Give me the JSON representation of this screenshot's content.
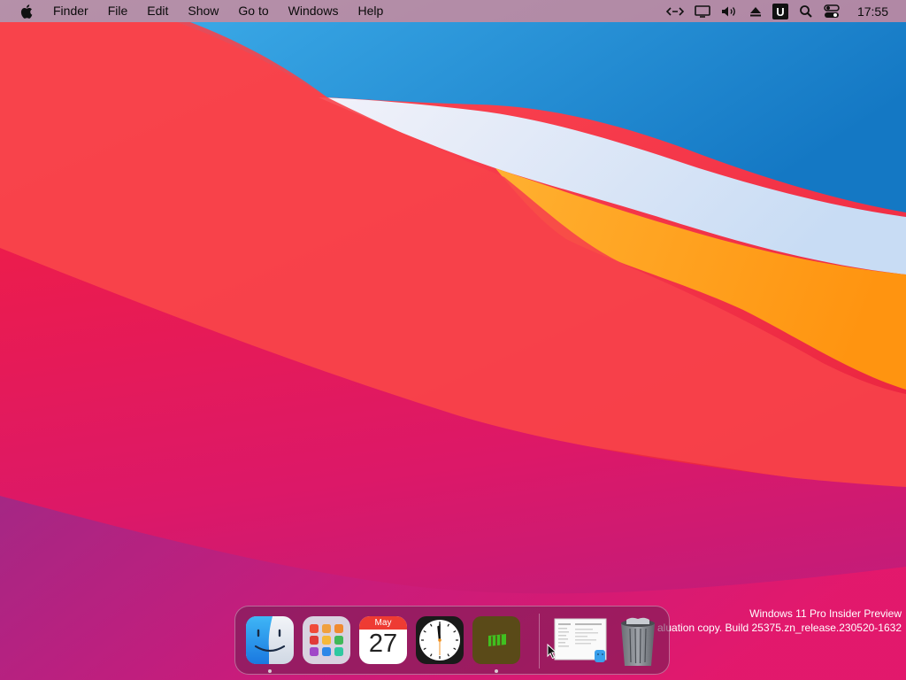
{
  "menubar": {
    "apple_icon": "apple-logo-icon",
    "items": [
      {
        "id": "finder",
        "label": "Finder"
      },
      {
        "id": "file",
        "label": "File"
      },
      {
        "id": "edit",
        "label": "Edit"
      },
      {
        "id": "show",
        "label": "Show"
      },
      {
        "id": "goto",
        "label": "Go to"
      },
      {
        "id": "windows",
        "label": "Windows"
      },
      {
        "id": "help",
        "label": "Help"
      }
    ],
    "tray_icons": [
      "code-arrows-icon",
      "display-icon",
      "volume-icon",
      "eject-icon",
      "u-app-icon",
      "search-icon",
      "control-center-icon"
    ],
    "u_app_letter": "U",
    "clock": "17:55"
  },
  "dock": {
    "apps": [
      {
        "name": "Finder",
        "icon": "finder-icon",
        "running": true
      },
      {
        "name": "Launchpad",
        "icon": "launchpad-icon",
        "running": false
      },
      {
        "name": "Calendar",
        "icon": "calendar-icon",
        "running": false,
        "month": "May",
        "day": "27"
      },
      {
        "name": "Clock",
        "icon": "clock-icon",
        "running": false
      },
      {
        "name": "Battery",
        "icon": "battery-app-icon",
        "running": true
      }
    ],
    "document_icon": "document-preview-icon",
    "trash_icon": "trash-icon"
  },
  "watermark": {
    "line1": "Windows 11 Pro Insider Preview",
    "line2": "aluation copy. Build 25375.zn_release.230520-1632"
  },
  "colors": {
    "menubar": "#78c8f0",
    "dock": "#6e1e50",
    "wallpaper_red": "#f02c4c",
    "wallpaper_blue": "#1a8ad0",
    "wallpaper_orange": "#ffa020"
  }
}
